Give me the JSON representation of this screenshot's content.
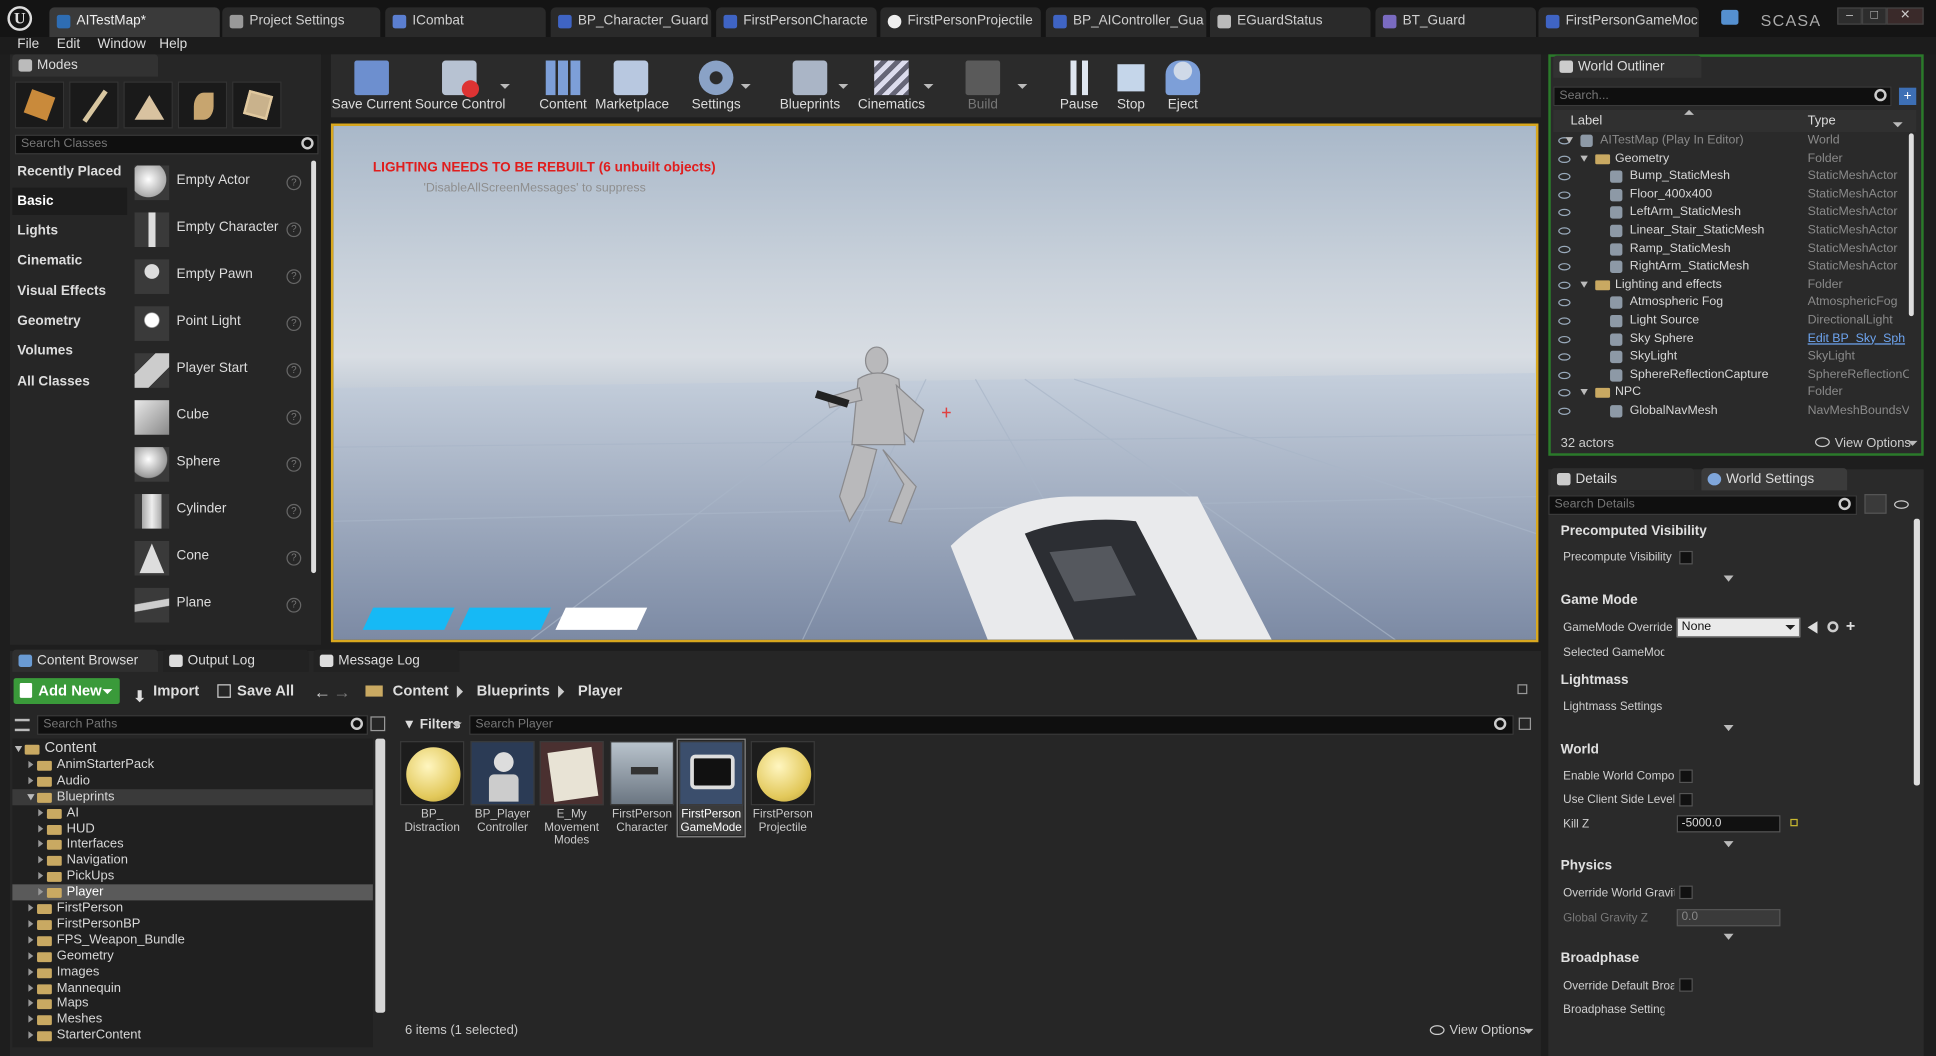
{
  "titlebar": {
    "tabs": [
      {
        "label": "AITestMap*",
        "icon": "level-icon"
      },
      {
        "label": "Project Settings",
        "icon": "gear-icon"
      },
      {
        "label": "ICombat",
        "icon": "blueprint-interface-icon"
      },
      {
        "label": "BP_Character_Guard",
        "icon": "blueprint-icon"
      },
      {
        "label": "FirstPersonCharacte",
        "icon": "blueprint-icon"
      },
      {
        "label": "FirstPersonProjectile",
        "icon": "blueprint-icon"
      },
      {
        "label": "BP_AIController_Gua",
        "icon": "blueprint-icon"
      },
      {
        "label": "EGuardStatus",
        "icon": "enum-icon"
      },
      {
        "label": "BT_Guard",
        "icon": "behavior-tree-icon"
      },
      {
        "label": "FirstPersonGameMoc",
        "icon": "blueprint-icon"
      }
    ],
    "user": "SCASA"
  },
  "menu": [
    "File",
    "Edit",
    "Window",
    "Help"
  ],
  "modes": {
    "title": "Modes",
    "search_placeholder": "Search Classes",
    "categories": [
      "Recently Placed",
      "Basic",
      "Lights",
      "Cinematic",
      "Visual Effects",
      "Geometry",
      "Volumes",
      "All Classes"
    ],
    "selected_category": "Basic",
    "items": [
      "Empty Actor",
      "Empty Character",
      "Empty Pawn",
      "Point Light",
      "Player Start",
      "Cube",
      "Sphere",
      "Cylinder",
      "Cone",
      "Plane"
    ]
  },
  "toolbar": {
    "buttons": [
      "Save Current",
      "Source Control",
      "Content",
      "Marketplace",
      "Settings",
      "Blueprints",
      "Cinematics",
      "Build",
      "Pause",
      "Stop",
      "Eject"
    ]
  },
  "viewport": {
    "warning": "LIGHTING NEEDS TO BE REBUILT (6 unbuilt objects)",
    "hint": "'DisableAllScreenMessages' to suppress"
  },
  "outliner": {
    "title": "World Outliner",
    "search_placeholder": "Search...",
    "col_label": "Label",
    "col_type": "Type",
    "rows": [
      {
        "name": "AITestMap (Play In Editor)",
        "type": "World"
      },
      {
        "name": "Geometry",
        "type": "Folder"
      },
      {
        "name": "Bump_StaticMesh",
        "type": "StaticMeshActor"
      },
      {
        "name": "Floor_400x400",
        "type": "StaticMeshActor"
      },
      {
        "name": "LeftArm_StaticMesh",
        "type": "StaticMeshActor"
      },
      {
        "name": "Linear_Stair_StaticMesh",
        "type": "StaticMeshActor"
      },
      {
        "name": "Ramp_StaticMesh",
        "type": "StaticMeshActor"
      },
      {
        "name": "RightArm_StaticMesh",
        "type": "StaticMeshActor"
      },
      {
        "name": "Lighting and effects",
        "type": "Folder"
      },
      {
        "name": "Atmospheric Fog",
        "type": "AtmosphericFog"
      },
      {
        "name": "Light Source",
        "type": "DirectionalLight"
      },
      {
        "name": "Sky Sphere",
        "type": "Edit BP_Sky_Sph"
      },
      {
        "name": "SkyLight",
        "type": "SkyLight"
      },
      {
        "name": "SphereReflectionCapture",
        "type": "SphereReflectionC"
      },
      {
        "name": "NPC",
        "type": "Folder"
      },
      {
        "name": "GlobalNavMesh",
        "type": "NavMeshBoundsV"
      }
    ],
    "count": "32 actors",
    "view_options": "View Options"
  },
  "details": {
    "tab_details": "Details",
    "tab_world": "World Settings",
    "search_placeholder": "Search Details",
    "sections": {
      "precomputed": "Precomputed Visibility",
      "gamemode": "Game Mode",
      "lightmass": "Lightmass",
      "world": "World",
      "physics": "Physics",
      "broadphase": "Broadphase"
    },
    "props": {
      "precompute_visibility": "Precompute Visibility",
      "gamemode_override": "GameMode Override",
      "gamemode_value": "None",
      "selected_gamemode": "Selected GameMode",
      "lightmass_settings": "Lightmass Settings",
      "enable_world_comp": "Enable World Composi",
      "use_client_side": "Use Client Side Level S",
      "kill_z": "Kill Z",
      "kill_z_value": "-5000.0",
      "override_gravity": "Override World Gravity",
      "global_gravity": "Global Gravity Z",
      "global_gravity_value": "0.0",
      "override_broadphase": "Override Default Broac",
      "broadphase_settings": "Broadphase Settings"
    }
  },
  "bottom_tabs": [
    "Content Browser",
    "Output Log",
    "Message Log"
  ],
  "content_browser": {
    "add_new": "Add New",
    "import": "Import",
    "save_all": "Save All",
    "path": [
      "Content",
      "Blueprints",
      "Player"
    ],
    "search_paths_placeholder": "Search Paths",
    "filters": "Filters",
    "search_placeholder": "Search Player",
    "tree": [
      {
        "name": "Content",
        "level": 0,
        "expanded": true
      },
      {
        "name": "AnimStarterPack",
        "level": 1
      },
      {
        "name": "Audio",
        "level": 1
      },
      {
        "name": "Blueprints",
        "level": 1,
        "expanded": true
      },
      {
        "name": "AI",
        "level": 2
      },
      {
        "name": "HUD",
        "level": 2
      },
      {
        "name": "Interfaces",
        "level": 2
      },
      {
        "name": "Navigation",
        "level": 2
      },
      {
        "name": "PickUps",
        "level": 2
      },
      {
        "name": "Player",
        "level": 2,
        "selected": true
      },
      {
        "name": "FirstPerson",
        "level": 1
      },
      {
        "name": "FirstPersonBP",
        "level": 1
      },
      {
        "name": "FPS_Weapon_Bundle",
        "level": 1
      },
      {
        "name": "Geometry",
        "level": 1
      },
      {
        "name": "Images",
        "level": 1
      },
      {
        "name": "Mannequin",
        "level": 1
      },
      {
        "name": "Maps",
        "level": 1
      },
      {
        "name": "Meshes",
        "level": 1
      },
      {
        "name": "StarterContent",
        "level": 1
      }
    ],
    "assets": [
      {
        "label": "BP_\nDistraction"
      },
      {
        "label": "BP_Player\nController"
      },
      {
        "label": "E_My\nMovement\nModes"
      },
      {
        "label": "FirstPerson\nCharacter"
      },
      {
        "label": "FirstPerson\nGameMode",
        "selected": true
      },
      {
        "label": "FirstPerson\nProjectile"
      }
    ],
    "status": "6 items (1 selected)",
    "view_options": "View Options"
  }
}
